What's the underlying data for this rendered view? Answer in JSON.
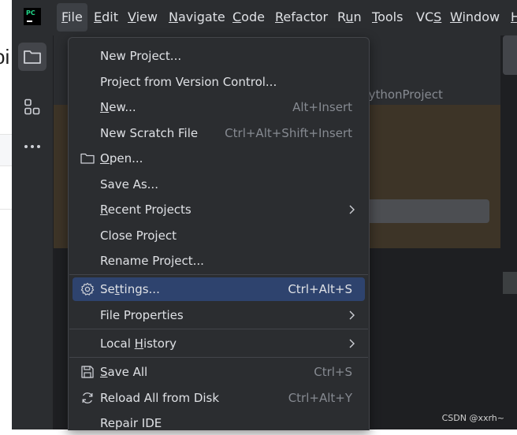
{
  "browser_remnant": {
    "heading_fragment": "oi"
  },
  "menubar": {
    "logo_text": "PC",
    "items": [
      {
        "label": "File",
        "mnemonic": "F",
        "rest": "ile"
      },
      {
        "label": "Edit",
        "mnemonic": "E",
        "rest": "dit"
      },
      {
        "label": "View",
        "mnemonic": "V",
        "rest": "iew"
      },
      {
        "label": "Navigate",
        "mnemonic": "N",
        "rest": "avigate"
      },
      {
        "label": "Code",
        "mnemonic": "C",
        "rest": "ode"
      },
      {
        "label": "Refactor",
        "mnemonic": "R",
        "rest": "efactor"
      },
      {
        "label": "Run",
        "pre": "R",
        "mnemonic": "u",
        "rest": "n"
      },
      {
        "label": "Tools",
        "mnemonic": "T",
        "rest": "ools"
      },
      {
        "label": "VCS",
        "pre": "VC",
        "mnemonic": "S",
        "rest": ""
      },
      {
        "label": "Window",
        "mnemonic": "W",
        "rest": "indow"
      },
      {
        "label": "H",
        "mnemonic": "H",
        "rest": ""
      }
    ]
  },
  "editor": {
    "project_path": "\\pythonProject"
  },
  "file_menu": {
    "items": [
      {
        "label": "New Project...",
        "shortcut": ""
      },
      {
        "label": "Project from Version Control...",
        "shortcut": ""
      },
      {
        "label": "New...",
        "mnemonic": "N",
        "rest": "ew...",
        "shortcut": "Alt+Insert"
      },
      {
        "label": "New Scratch File",
        "shortcut": "Ctrl+Alt+Shift+Insert"
      },
      {
        "label": "Open...",
        "mnemonic": "O",
        "rest": "pen...",
        "shortcut": "",
        "icon": "folder-icon"
      },
      {
        "label": "Save As...",
        "shortcut": ""
      },
      {
        "label": "Recent Projects",
        "mnemonic": "R",
        "rest": "ecent Projects",
        "shortcut": "",
        "submenu": true
      },
      {
        "label": "Close Project",
        "shortcut": ""
      },
      {
        "label": "Rename Project...",
        "shortcut": ""
      },
      {
        "label": "Settings...",
        "pre": "Se",
        "mnemonic": "t",
        "rest": "tings...",
        "shortcut": "Ctrl+Alt+S",
        "icon": "gear-icon",
        "highlighted": true
      },
      {
        "label": "File Properties",
        "shortcut": "",
        "submenu": true
      },
      {
        "label": "Local History",
        "pre": "Local ",
        "mnemonic": "H",
        "rest": "istory",
        "shortcut": "",
        "submenu": true
      },
      {
        "label": "Save All",
        "mnemonic": "S",
        "rest": "ave All",
        "shortcut": "Ctrl+S",
        "icon": "save-icon"
      },
      {
        "label": "Reload All from Disk",
        "shortcut": "Ctrl+Alt+Y",
        "icon": "reload-icon"
      },
      {
        "label": "Repair IDE",
        "shortcut": ""
      }
    ]
  },
  "watermark": "CSDN @xxrh~",
  "colors": {
    "menu_bg": "#2b2d30",
    "highlight": "#2e436e",
    "text": "#dfe1e5",
    "shortcut_text": "#868a91"
  }
}
